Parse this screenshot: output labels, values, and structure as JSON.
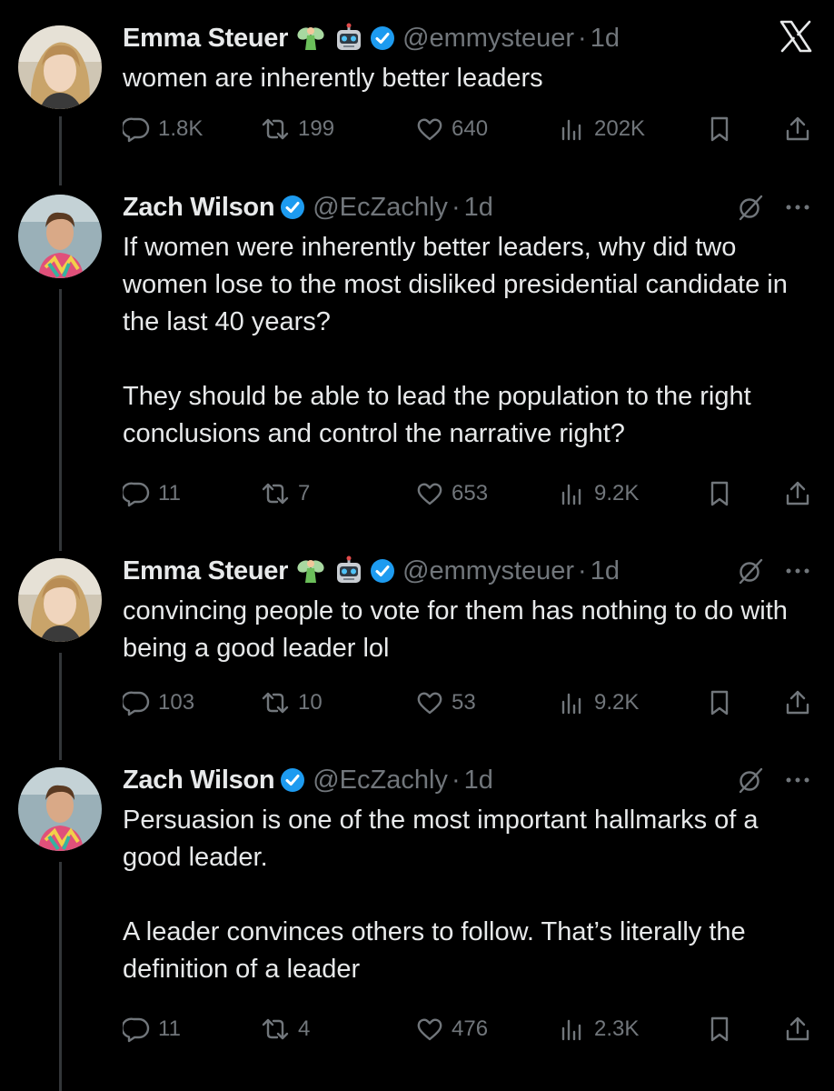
{
  "tweets": [
    {
      "name": "Emma Steuer",
      "emojis": [
        "fairy",
        "robot"
      ],
      "verified": true,
      "handle": "@emmysteuer",
      "separator": "·",
      "time": "1d",
      "paragraphs": [
        "women are inherently better leaders"
      ],
      "replies": "1.8K",
      "reposts": "199",
      "likes": "640",
      "views": "202K"
    },
    {
      "name": "Zach Wilson",
      "emojis": [],
      "verified": true,
      "handle": "@EcZachly",
      "separator": "·",
      "time": "1d",
      "paragraphs": [
        "If women were inherently better leaders, why did two women lose to the most disliked presidential candidate in the last 40 years?",
        "They should be able to lead the population to the right conclusions and control the narrative right?"
      ],
      "replies": "11",
      "reposts": "7",
      "likes": "653",
      "views": "9.2K"
    },
    {
      "name": "Emma Steuer",
      "emojis": [
        "fairy",
        "robot"
      ],
      "verified": true,
      "handle": "@emmysteuer",
      "separator": "·",
      "time": "1d",
      "paragraphs": [
        "convincing people to vote for them has nothing to do with being a good leader lol"
      ],
      "replies": "103",
      "reposts": "10",
      "likes": "53",
      "views": "9.2K"
    },
    {
      "name": "Zach Wilson",
      "emojis": [],
      "verified": true,
      "handle": "@EcZachly",
      "separator": "·",
      "time": "1d",
      "paragraphs": [
        "Persuasion is one of the most important hallmarks of a good leader.",
        "A leader convinces others to follow. That’s literally the definition of a leader"
      ],
      "replies": "11",
      "reposts": "4",
      "likes": "476",
      "views": "2.3K"
    }
  ],
  "icons": {
    "app": "x-logo-icon",
    "reply": "reply-icon",
    "repost": "repost-icon",
    "like": "like-icon",
    "views": "views-icon",
    "bookmark": "bookmark-icon",
    "share": "share-icon",
    "grok": "grok-icon",
    "more": "more-icon",
    "verified": "verified-badge-icon"
  },
  "colors": {
    "background": "#000000",
    "text": "#e7e9ea",
    "muted": "#71767b",
    "verified": "#1d9bf0",
    "thread_line": "#333639"
  }
}
